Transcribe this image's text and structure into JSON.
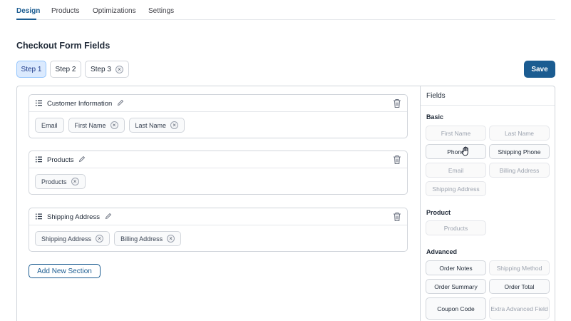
{
  "tabs": [
    {
      "label": "Design",
      "active": true
    },
    {
      "label": "Products",
      "active": false
    },
    {
      "label": "Optimizations",
      "active": false
    },
    {
      "label": "Settings",
      "active": false
    }
  ],
  "page_title": "Checkout Form Fields",
  "steps": [
    {
      "label": "Step 1",
      "active": true
    },
    {
      "label": "Step 2",
      "active": false
    },
    {
      "label": "Step 3",
      "active": false,
      "removable": true
    }
  ],
  "save_label": "Save",
  "sections": [
    {
      "title": "Customer Information",
      "fields": [
        "Email",
        "First Name",
        "Last Name"
      ]
    },
    {
      "title": "Products",
      "fields": [
        "Products"
      ]
    },
    {
      "title": "Shipping Address",
      "fields": [
        "Shipping Address",
        "Billing Address"
      ]
    }
  ],
  "add_section_label": "Add New Section",
  "fields_panel": {
    "title": "Fields",
    "groups": [
      {
        "title": "Basic",
        "fields": [
          {
            "label": "First Name",
            "enabled": false
          },
          {
            "label": "Last Name",
            "enabled": false
          },
          {
            "label": "Phone",
            "enabled": true
          },
          {
            "label": "Shipping Phone",
            "enabled": true
          },
          {
            "label": "Email",
            "enabled": false
          },
          {
            "label": "Billing Address",
            "enabled": false
          },
          {
            "label": "Shipping Address",
            "enabled": false
          }
        ]
      },
      {
        "title": "Product",
        "fields": [
          {
            "label": "Products",
            "enabled": false
          }
        ]
      },
      {
        "title": "Advanced",
        "fields": [
          {
            "label": "Order Notes",
            "enabled": true
          },
          {
            "label": "Shipping Method",
            "enabled": false
          },
          {
            "label": "Order Summary",
            "enabled": true
          },
          {
            "label": "Order Total",
            "enabled": true
          },
          {
            "label": "Coupon Code",
            "enabled": true
          },
          {
            "label": "Extra Advanced Field",
            "enabled": false
          }
        ]
      }
    ]
  },
  "colors": {
    "accent": "#1b5c91",
    "active_step_bg": "#dbeafe",
    "border": "#d1d5db",
    "disabled_text": "#9ca3af"
  },
  "icons": {
    "drag": "drag-handle-icon",
    "edit": "pencil-icon",
    "delete": "trash-icon",
    "remove": "close-icon",
    "cursor": "grab-hand-cursor-icon"
  }
}
